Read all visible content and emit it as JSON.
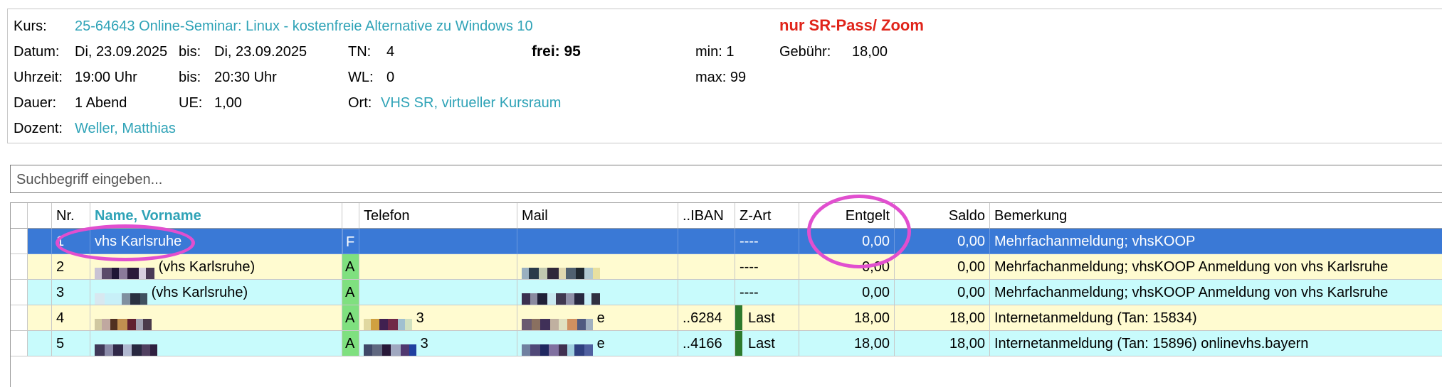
{
  "course": {
    "kurs_label": "Kurs:",
    "kurs_value": "25-64643 Online-Seminar: Linux - kostenfreie Alternative zu Windows 10",
    "notice": "nur SR-Pass/ Zoom",
    "datum_label": "Datum:",
    "datum_value": "Di, 23.09.2025",
    "bis1_label": "bis:",
    "bis1_value": "Di, 23.09.2025",
    "tn_label": "TN:",
    "tn_value": "4",
    "frei": "frei: 95",
    "min": "min: 1",
    "gebuehr_label": "Gebühr:",
    "gebuehr_value": "18,00",
    "uhrzeit_label": "Uhrzeit:",
    "uhrzeit_value": "19:00 Uhr",
    "bis2_label": "bis:",
    "bis2_value": "20:30 Uhr",
    "wl_label": "WL:",
    "wl_value": "0",
    "max": "max: 99",
    "dauer_label": "Dauer:",
    "dauer_value": "1 Abend",
    "ue_label": "UE:",
    "ue_value": "1,00",
    "ort_label": "Ort:",
    "ort_value": "VHS SR, virtueller Kursraum",
    "dozent_label": "Dozent:",
    "dozent_value": "Weller, Matthias"
  },
  "search": {
    "placeholder": "Suchbegriff eingeben..."
  },
  "table": {
    "headers": {
      "nr": "Nr.",
      "name": "Name, Vorname",
      "telefon": "Telefon",
      "mail": "Mail",
      "iban": "..IBAN",
      "zart": "Z-Art",
      "entgelt": "Entgelt",
      "saldo": "Saldo",
      "bemerkung": "Bemerkung"
    },
    "rows": [
      {
        "nr": "1",
        "name": "vhs Karlsruhe",
        "status": "F",
        "telefon": "",
        "mail": "",
        "iban": "",
        "zart": "----",
        "entgelt": "0,00",
        "saldo": "0,00",
        "bemerkung": "Mehrfachanmeldung; vhsKOOP"
      },
      {
        "nr": "2",
        "name": "(vhs Karlsruhe)",
        "status": "A",
        "telefon": "",
        "mail": "",
        "iban": "",
        "zart": "----",
        "entgelt": "0,00",
        "saldo": "0,00",
        "bemerkung": "Mehrfachanmeldung; vhsKOOP Anmeldung von vhs Karlsruhe"
      },
      {
        "nr": "3",
        "name": "(vhs Karlsruhe)",
        "status": "A",
        "telefon": "",
        "mail": "",
        "iban": "",
        "zart": "----",
        "entgelt": "0,00",
        "saldo": "0,00",
        "bemerkung": "Mehrfachanmeldung; vhsKOOP Anmeldung von vhs Karlsruhe"
      },
      {
        "nr": "4",
        "name": "",
        "status": "A",
        "telefon": "3",
        "mail": "e",
        "iban": "..6284",
        "zart": "Last",
        "entgelt": "18,00",
        "saldo": "18,00",
        "bemerkung": "Internetanmeldung (Tan: 15834)"
      },
      {
        "nr": "5",
        "name": "",
        "status": "A",
        "telefon": "3",
        "mail": "e",
        "iban": "..4166",
        "zart": "Last",
        "entgelt": "18,00",
        "saldo": "18,00",
        "bemerkung": "Internetanmeldung (Tan: 15896) onlinevhs.bayern"
      }
    ]
  },
  "colors": {
    "highlight_circle": "#e14fcf",
    "selected_row": "#3a79d6",
    "row_yellow": "#fffbd0",
    "row_cyan": "#c8fbfc",
    "status_a": "#7fe07f",
    "teal_text": "#2fa3b7",
    "notice_red": "#e0241a"
  },
  "icons": {
    "blurred_text": "pixelated-redaction"
  }
}
